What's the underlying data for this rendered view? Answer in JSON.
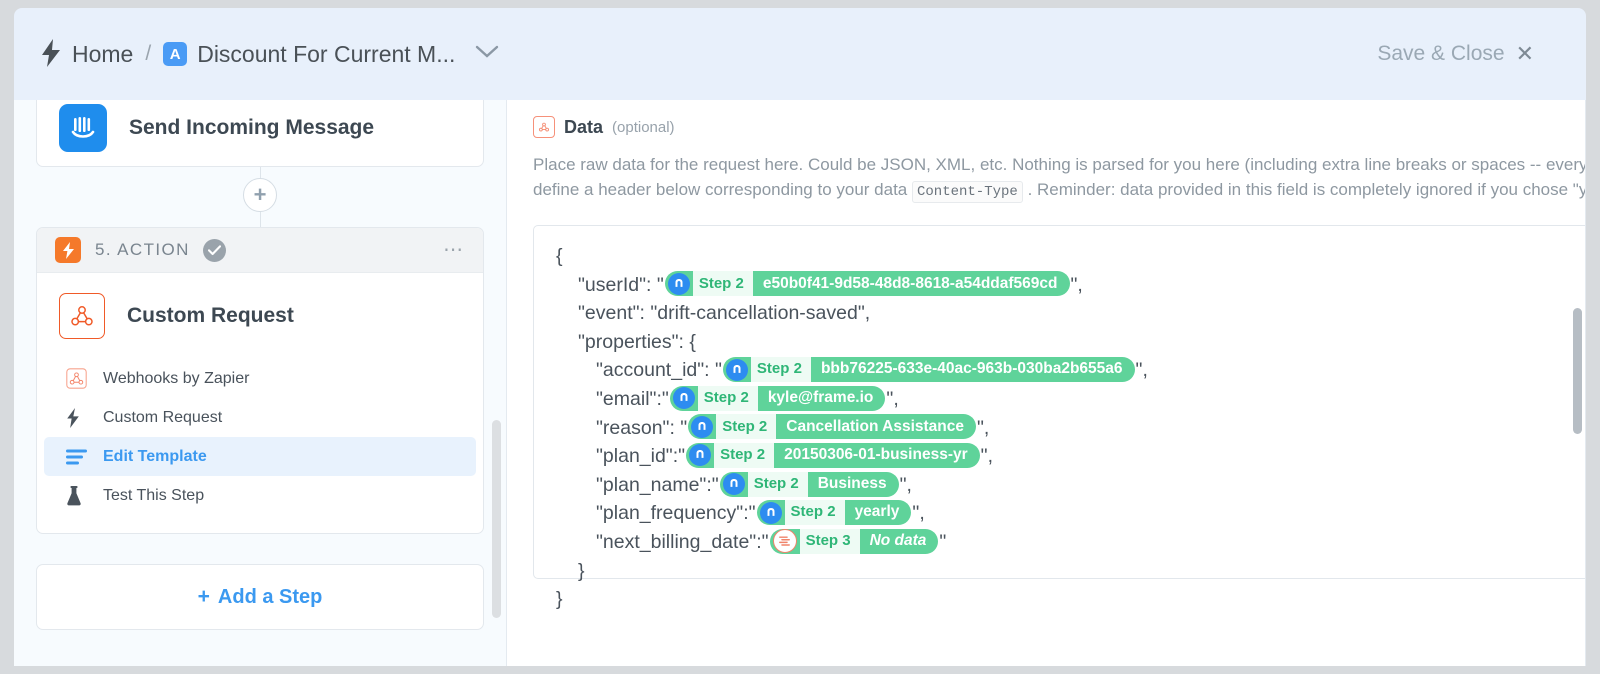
{
  "header": {
    "bolt_icon": "lightning-icon",
    "home_label": "Home",
    "separator": "/",
    "zap_badge": "A",
    "zap_title": "Discount For Current M...",
    "chevron": "chevron-down-icon",
    "save_close_label": "Save & Close",
    "close_icon": "✕"
  },
  "sidebar": {
    "previous_step": {
      "icon": "intercom-icon",
      "title": "Send Incoming Message"
    },
    "add_connector_label": "+",
    "action_card": {
      "zap_icon": "zap-icon",
      "number_label": "5. ACTION",
      "status_icon": "check-circle-icon",
      "overflow_icon": "ellipsis-icon",
      "app_icon": "webhooks-icon",
      "app_title": "Custom Request",
      "menu": [
        {
          "icon": "webhooks-icon",
          "label": "Webhooks by Zapier",
          "active": false
        },
        {
          "icon": "zap-icon",
          "label": "Custom Request",
          "active": false
        },
        {
          "icon": "template-lines-icon",
          "label": "Edit Template",
          "active": true
        },
        {
          "icon": "flask-icon",
          "label": "Test This Step",
          "active": false
        }
      ]
    },
    "add_step_plus": "+",
    "add_step_label": "Add a Step"
  },
  "main": {
    "field": {
      "icon": "webhooks-icon",
      "name": "Data",
      "optional_label": "(optional)",
      "help_part1": "Place raw data for the request here. Could be JSON, XML, etc. Nothing is parsed for you here (including extra line breaks or spaces -- everything is sent verbatim). You probably need to define a header below corresponding to your data",
      "help_code": "Content-Type",
      "help_part2": ". Reminder: data provided in this field is completely ignored if you chose \"yes\" to pass-through."
    },
    "editor": {
      "insert_field_icon": "insert-field-icon",
      "lines": [
        {
          "indent": 0,
          "text": "{"
        },
        {
          "indent": 1,
          "text": "\"userId\": \"",
          "pill": {
            "icon": "drift-icon",
            "icon_type": "drift",
            "step": "Step 2",
            "value": "e50b0f41-9d58-48d8-8618-a54ddaf569cd",
            "italic": false
          },
          "after": "\","
        },
        {
          "indent": 1,
          "text": "\"event\": \"drift-cancellation-saved\","
        },
        {
          "indent": 1,
          "text": "\"properties\": {"
        },
        {
          "indent": 2,
          "text": "\"account_id\": \"",
          "pill": {
            "icon": "drift-icon",
            "icon_type": "drift",
            "step": "Step 2",
            "value": "bbb76225-633e-40ac-963b-030ba2b655a6",
            "italic": false
          },
          "after": "\","
        },
        {
          "indent": 2,
          "text": "\"email\":\"",
          "pill": {
            "icon": "drift-icon",
            "icon_type": "drift",
            "step": "Step 2",
            "value": "kyle@frame.io",
            "italic": false
          },
          "after": "\","
        },
        {
          "indent": 2,
          "text": "\"reason\": \"",
          "pill": {
            "icon": "drift-icon",
            "icon_type": "drift",
            "step": "Step 2",
            "value": "Cancellation Assistance",
            "italic": false
          },
          "after": "\","
        },
        {
          "indent": 2,
          "text": "\"plan_id\":\"",
          "pill": {
            "icon": "drift-icon",
            "icon_type": "drift",
            "step": "Step 2",
            "value": "20150306-01-business-yr",
            "italic": false
          },
          "after": "\","
        },
        {
          "indent": 2,
          "text": "\"plan_name\":\"",
          "pill": {
            "icon": "drift-icon",
            "icon_type": "drift",
            "step": "Step 2",
            "value": "Business",
            "italic": false
          },
          "after": "\","
        },
        {
          "indent": 2,
          "text": "\"plan_frequency\":\"",
          "pill": {
            "icon": "drift-icon",
            "icon_type": "drift",
            "step": "Step 2",
            "value": "yearly",
            "italic": false
          },
          "after": "\","
        },
        {
          "indent": 2,
          "text": "\"next_billing_date\":\"",
          "pill": {
            "icon": "formatter-icon",
            "icon_type": "formatter",
            "step": "Step 3",
            "value": "No data",
            "italic": true
          },
          "after": "\""
        },
        {
          "indent": 1,
          "text": "}"
        },
        {
          "indent": 0,
          "text": "}"
        }
      ]
    }
  },
  "colors": {
    "header_bg": "#e8f0fb",
    "accent_blue": "#3b99f0",
    "zap_orange": "#f5792a",
    "pill_green": "#5fd39a",
    "pill_green_text": "#2fb677",
    "webhook_red": "#f05a28",
    "drift_blue": "#2d8cf0",
    "page_bg": "#d7dadd"
  }
}
